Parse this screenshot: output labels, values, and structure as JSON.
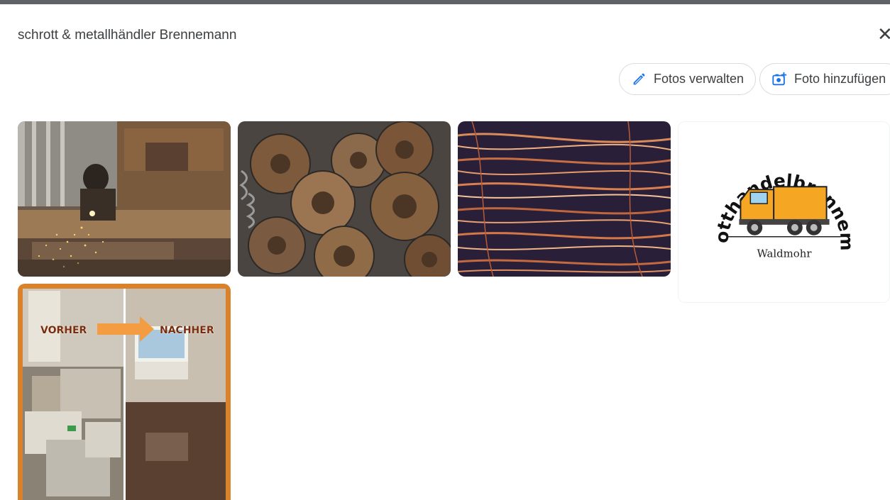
{
  "dialog": {
    "title": "schrott & metallhändler Brennemann",
    "close_icon": "close-icon"
  },
  "actions": {
    "manage_label": "Fotos verwalten",
    "manage_icon": "pencil-icon",
    "add_label": "Foto hinzufügen",
    "add_icon": "add-photo-icon"
  },
  "photos": [
    {
      "subject": "metal-cutting-sparks"
    },
    {
      "subject": "rusty-brake-discs"
    },
    {
      "subject": "copper-wire"
    },
    {
      "subject": "company-logo",
      "logo_text": "Schrotthandelbrennemann",
      "logo_sub": "Waldmohr"
    },
    {
      "subject": "before-after-clearance",
      "before_label": "VORHER",
      "after_label": "NACHHER"
    }
  ],
  "colors": {
    "accent_blue": "#1a73e8",
    "border": "#dadce0",
    "text": "#3c4043",
    "truck_yellow": "#f5a623",
    "frame_orange": "#d9822b"
  }
}
